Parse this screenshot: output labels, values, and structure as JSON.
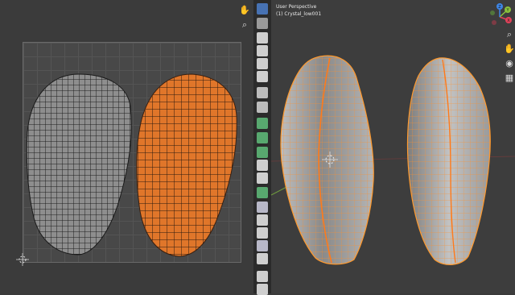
{
  "viewport": {
    "view_name": "User Perspective",
    "object_name": "(1) Crystal_low001"
  },
  "gizmo": {
    "axis_x": "X",
    "axis_y": "Y",
    "axis_z": "Z"
  },
  "colors": {
    "selected_mesh": "#e0762a",
    "wire": "#222222",
    "vertex_orange": "#ff9a2e",
    "active_tool": "#4772b3",
    "axis_x": "#e2425a",
    "axis_y": "#8bc33c",
    "axis_z": "#3e86e6"
  },
  "icons": {
    "uv_navigation": [
      "hand-icon",
      "zoom-icon"
    ],
    "toolbar": [
      "select-box-icon",
      "cursor-icon",
      "move-icon",
      "rotate-icon",
      "scale-icon",
      "transform-icon",
      "annotate-icon",
      "measure-icon",
      "add-cube-icon",
      "extrude-icon",
      "inset-icon",
      "bevel-icon",
      "loop-cut-icon",
      "knife-icon",
      "poly-build-icon",
      "spin-icon",
      "smooth-icon",
      "edge-slide-icon",
      "shrink-fatten-icon",
      "shear-icon",
      "rip-icon"
    ],
    "viewport_navigation": [
      "zoom-icon",
      "hand-icon",
      "camera-icon",
      "grid-icon"
    ]
  }
}
